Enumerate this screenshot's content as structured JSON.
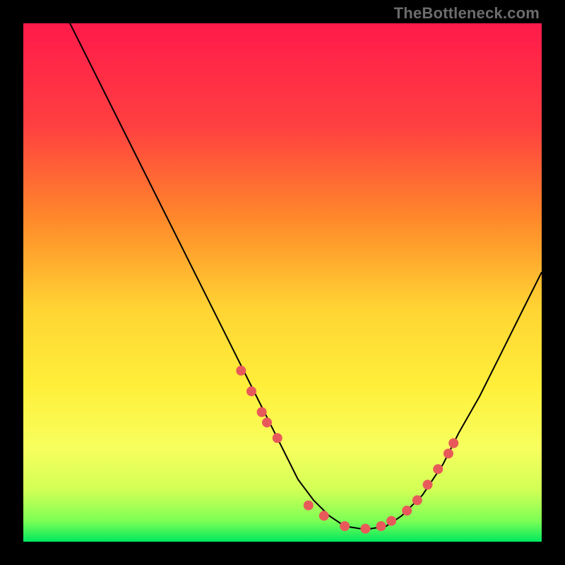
{
  "watermark": "TheBottleneck.com",
  "colors": {
    "top": "#ff1a4b",
    "upper_mid": "#ff8f2a",
    "mid": "#ffe733",
    "lower_mid": "#faff66",
    "low": "#d6ff5a",
    "bottom": "#00e85e",
    "curve": "#000000",
    "marker": "#e85a5a",
    "background": "#000000"
  },
  "gradient_stops": [
    {
      "offset": 0.0,
      "color": "#ff1a4b"
    },
    {
      "offset": 0.2,
      "color": "#ff4040"
    },
    {
      "offset": 0.38,
      "color": "#ff8a2a"
    },
    {
      "offset": 0.55,
      "color": "#ffd433"
    },
    {
      "offset": 0.7,
      "color": "#ffef3a"
    },
    {
      "offset": 0.82,
      "color": "#f7ff5e"
    },
    {
      "offset": 0.9,
      "color": "#d2ff55"
    },
    {
      "offset": 0.96,
      "color": "#7dff55"
    },
    {
      "offset": 1.0,
      "color": "#00e85e"
    }
  ],
  "chart_data": {
    "type": "line",
    "title": "",
    "xlabel": "",
    "ylabel": "",
    "xlim": [
      0,
      100
    ],
    "ylim": [
      0,
      100
    ],
    "series": [
      {
        "name": "curve",
        "x": [
          6,
          10,
          15,
          20,
          25,
          30,
          35,
          40,
          45,
          47,
          50,
          53,
          56,
          59,
          62,
          65,
          67,
          70,
          73,
          77,
          81,
          84,
          88,
          92,
          96,
          100
        ],
        "y": [
          106,
          98,
          88,
          78,
          68,
          58,
          48,
          38,
          28,
          24,
          18,
          12,
          8,
          5,
          3,
          2.5,
          2.5,
          3,
          5,
          9,
          15,
          21,
          28,
          36,
          44,
          52
        ]
      }
    ],
    "markers": {
      "name": "highlight-points",
      "x": [
        42,
        44,
        46,
        47,
        49,
        55,
        58,
        62,
        66,
        69,
        71,
        74,
        76,
        78,
        80,
        82,
        83
      ],
      "y": [
        33,
        29,
        25,
        23,
        20,
        7,
        5,
        3,
        2.5,
        3,
        4,
        6,
        8,
        11,
        14,
        17,
        19
      ]
    }
  }
}
